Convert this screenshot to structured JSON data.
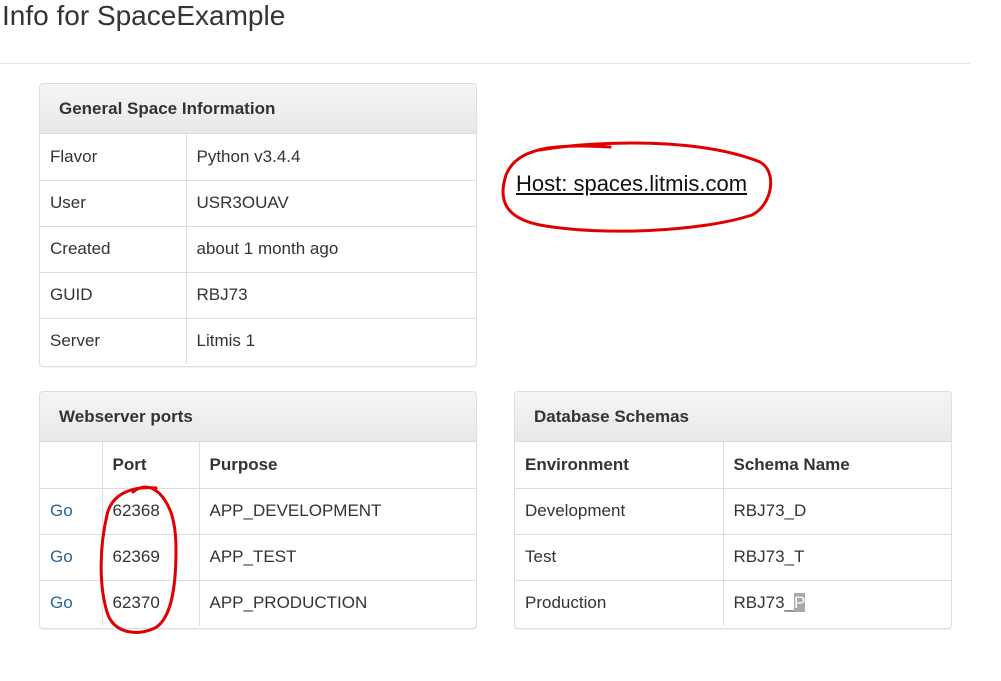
{
  "page": {
    "title": "Info for SpaceExample"
  },
  "general": {
    "heading": "General Space Information",
    "rows": [
      {
        "label": "Flavor",
        "value": "Python v3.4.4"
      },
      {
        "label": "User",
        "value": "USR3OUAV"
      },
      {
        "label": "Created",
        "value": "about 1 month ago"
      },
      {
        "label": "GUID",
        "value": "RBJ73"
      },
      {
        "label": "Server",
        "value": "Litmis 1"
      }
    ]
  },
  "host": {
    "text": "Host: spaces.litmis.com"
  },
  "ports": {
    "heading": "Webserver ports",
    "col_port": "Port",
    "col_purpose": "Purpose",
    "rows": [
      {
        "link": "Go",
        "port": "62368",
        "purpose": "APP_DEVELOPMENT"
      },
      {
        "link": "Go",
        "port": "62369",
        "purpose": "APP_TEST"
      },
      {
        "link": "Go",
        "port": "62370",
        "purpose": "APP_PRODUCTION"
      }
    ]
  },
  "schemas": {
    "heading": "Database Schemas",
    "col_env": "Environment",
    "col_schema": "Schema Name",
    "rows": [
      {
        "env": "Development",
        "schema": "RBJ73_D"
      },
      {
        "env": "Test",
        "schema": "RBJ73_T"
      },
      {
        "env": "Production",
        "schema_prefix": "RBJ73_",
        "schema_highlight": "P"
      }
    ]
  },
  "colors": {
    "link": "#2a6496",
    "annotation": "#e00000"
  }
}
